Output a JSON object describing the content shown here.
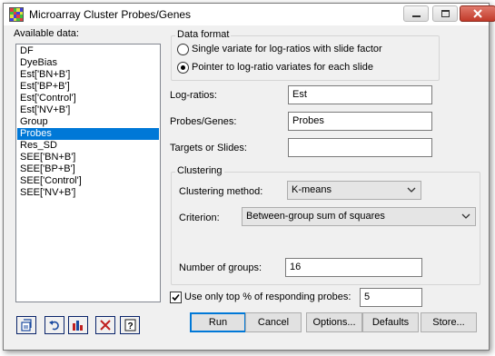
{
  "window": {
    "title": "Microarray Cluster Probes/Genes"
  },
  "available_data": {
    "label": "Available data:",
    "items": [
      "DF",
      "DyeBias",
      "Est['BN+B']",
      "Est['BP+B']",
      "Est['Control']",
      "Est['NV+B']",
      "Group",
      "Probes",
      "Res_SD",
      "SEE['BN+B']",
      "SEE['BP+B']",
      "SEE['Control']",
      "SEE['NV+B']"
    ],
    "selected": "Probes"
  },
  "data_format": {
    "legend": "Data format",
    "option1": "Single variate for log-ratios with slide factor",
    "option2": "Pointer to log-ratio variates for each slide",
    "selected": "option2"
  },
  "fields": {
    "log_ratios_label": "Log-ratios:",
    "log_ratios_value": "Est",
    "probes_label": "Probes/Genes:",
    "probes_value": "Probes",
    "targets_label": "Targets or Slides:",
    "targets_value": ""
  },
  "clustering": {
    "legend": "Clustering",
    "method_label": "Clustering method:",
    "method_value": "K-means",
    "criterion_label": "Criterion:",
    "criterion_value": "Between-group sum of squares",
    "groups_label": "Number of groups:",
    "groups_value": "16"
  },
  "top_percent": {
    "label": "Use only top % of responding probes:",
    "checked": true,
    "value": "5"
  },
  "buttons": {
    "run": "Run",
    "cancel": "Cancel",
    "options": "Options...",
    "defaults": "Defaults",
    "store": "Store..."
  },
  "icons": [
    "copy-icon",
    "undo-icon",
    "chart-icon",
    "clear-icon",
    "help-icon"
  ],
  "colors": {
    "selection": "#0078d7",
    "close_button": "#c23a2a"
  }
}
